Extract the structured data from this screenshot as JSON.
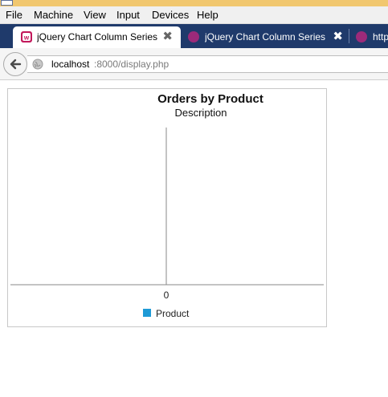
{
  "menubar": {
    "items": [
      "File",
      "Machine",
      "View",
      "Input",
      "Devices",
      "Help"
    ]
  },
  "tabs": [
    {
      "label": "jQuery Chart Column Series E...",
      "close": "✖"
    },
    {
      "label": "jQuery Chart Column Series E...",
      "close": "✖"
    },
    {
      "label": "http",
      "close": ""
    }
  ],
  "navbar": {
    "url_host": "localhost",
    "url_rest": ":8000/display.php",
    "back_icon": "back-arrow-icon",
    "site_icon": "globe-icon"
  },
  "colors": {
    "vm_titlebar": "#f1c76f",
    "tab_strip": "#1f3a6b",
    "active_favicon": "#c2185b",
    "inactive_favicon": "#9c2a7a",
    "series": "#1e9ad6",
    "axis": "#888888"
  },
  "chart_data": {
    "type": "bar",
    "title": "Orders by Product",
    "subtitle": "Description",
    "categories": [],
    "series": [
      {
        "name": "Product",
        "values": []
      }
    ],
    "x_tick_labels": [
      "0"
    ],
    "legend": "bottom-center",
    "grid": false
  }
}
